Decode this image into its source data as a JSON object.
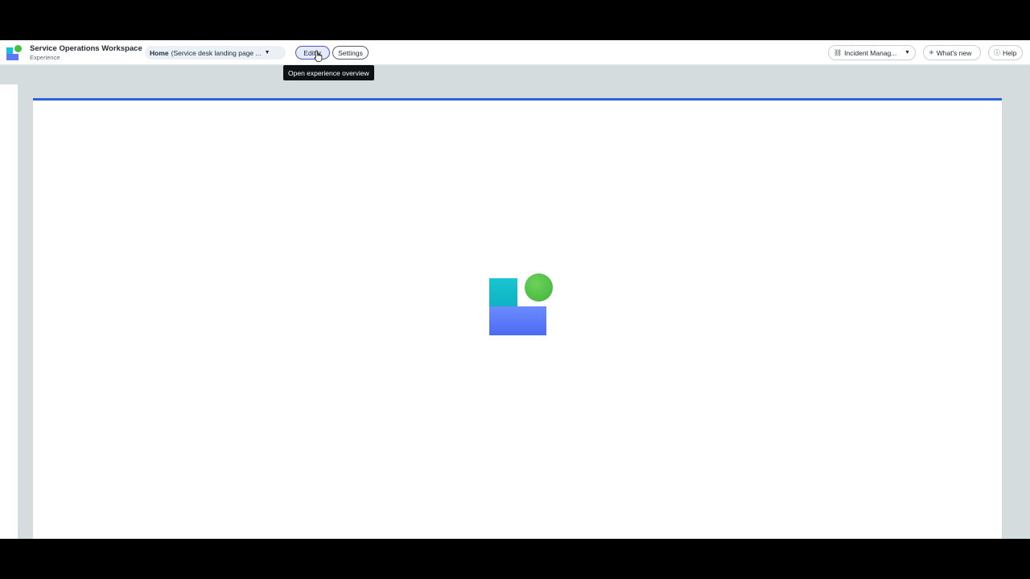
{
  "header": {
    "title": "Service Operations Workspace",
    "subtitle": "Experience",
    "page_select_home": "Home",
    "page_select_rest": "(Service desk landing page ...",
    "editor_label": "Editor",
    "settings_label": "Settings",
    "tooltip": "Open experience overview",
    "app_select_label": "Incident Manag...",
    "whats_new_label": "What's new",
    "help_label": "Help"
  },
  "icons": {
    "brand": "servicenow-logo-icon",
    "page_caret": "caret-down-icon",
    "app_icon": "app-icon",
    "whats_new_icon": "sparkle-icon",
    "help_icon": "question-circle-icon",
    "loader": "loading-logo-icon",
    "cursor": "hand-pointer-icon"
  },
  "colors": {
    "accent_blue": "#2d62d9",
    "logo_teal": "#16c1d3",
    "logo_green": "#41c041",
    "logo_blue": "#5b79f6",
    "canvas_bg": "#d5dcdd"
  }
}
